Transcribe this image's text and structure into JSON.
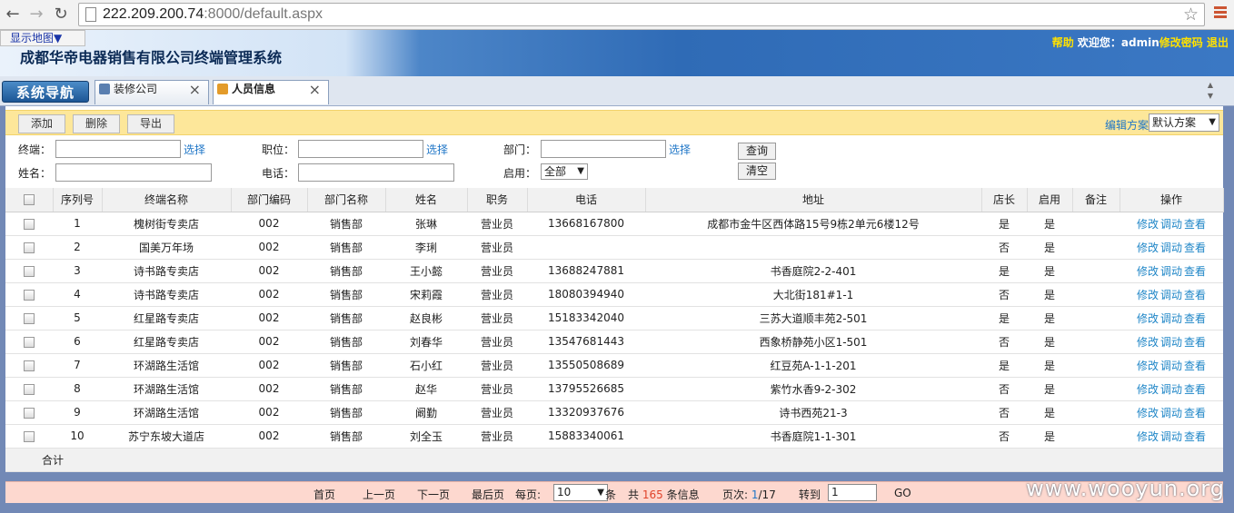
{
  "browser": {
    "url_host": "222.209.200.74",
    "url_rest": ":8000/default.aspx"
  },
  "header": {
    "map_toggle": "显示地图▼",
    "title": "成都华帝电器销售有限公司终端管理系统",
    "help": "帮助",
    "welcome": "欢迎您：admin",
    "change_password": "修改密码",
    "logout": "退出"
  },
  "tabs": {
    "system_nav": "系统导航",
    "items": [
      {
        "label": "装修公司"
      },
      {
        "label": "人员信息"
      }
    ],
    "close_glyph": "×"
  },
  "toolbar": {
    "add": "添加",
    "delete": "删除",
    "export": "导出",
    "edit_scheme": "编辑方案",
    "scheme_value": "默认方案"
  },
  "filters": {
    "terminal_label": "终端：",
    "position_label": "职位：",
    "department_label": "部门：",
    "name_label": "姓名：",
    "phone_label": "电话：",
    "enabled_label": "启用：",
    "pick": "选择",
    "enabled_value": "全部",
    "query": "查询",
    "clear": "清空"
  },
  "table": {
    "headers": [
      "序列号",
      "终端名称",
      "部门编码",
      "部门名称",
      "姓名",
      "职务",
      "电话",
      "地址",
      "店长",
      "启用",
      "备注",
      "操作"
    ],
    "actions": [
      "修改",
      "调动",
      "查看"
    ],
    "rows": [
      {
        "no": "1",
        "terminal": "槐树街专卖店",
        "dept_code": "002",
        "dept": "销售部",
        "name": "张琳",
        "role": "营业员",
        "phone": "13668167800",
        "address": "成都市金牛区西体路15号9栋2单元6楼12号",
        "manager": "是",
        "enabled": "是",
        "note": ""
      },
      {
        "no": "2",
        "terminal": "国美万年场",
        "dept_code": "002",
        "dept": "销售部",
        "name": "李琍",
        "role": "营业员",
        "phone": "",
        "address": "",
        "manager": "否",
        "enabled": "是",
        "note": ""
      },
      {
        "no": "3",
        "terminal": "诗书路专卖店",
        "dept_code": "002",
        "dept": "销售部",
        "name": "王小懿",
        "role": "营业员",
        "phone": "13688247881",
        "address": "书香庭院2-2-401",
        "manager": "是",
        "enabled": "是",
        "note": ""
      },
      {
        "no": "4",
        "terminal": "诗书路专卖店",
        "dept_code": "002",
        "dept": "销售部",
        "name": "宋莉霞",
        "role": "营业员",
        "phone": "18080394940",
        "address": "大北街181#1-1",
        "manager": "否",
        "enabled": "是",
        "note": ""
      },
      {
        "no": "5",
        "terminal": "红星路专卖店",
        "dept_code": "002",
        "dept": "销售部",
        "name": "赵良彬",
        "role": "营业员",
        "phone": "15183342040",
        "address": "三苏大道顺丰苑2-501",
        "manager": "是",
        "enabled": "是",
        "note": ""
      },
      {
        "no": "6",
        "terminal": "红星路专卖店",
        "dept_code": "002",
        "dept": "销售部",
        "name": "刘春华",
        "role": "营业员",
        "phone": "13547681443",
        "address": "西象桥静苑小区1-501",
        "manager": "否",
        "enabled": "是",
        "note": ""
      },
      {
        "no": "7",
        "terminal": "环湖路生活馆",
        "dept_code": "002",
        "dept": "销售部",
        "name": "石小红",
        "role": "营业员",
        "phone": "13550508689",
        "address": "红豆苑A-1-1-201",
        "manager": "是",
        "enabled": "是",
        "note": ""
      },
      {
        "no": "8",
        "terminal": "环湖路生活馆",
        "dept_code": "002",
        "dept": "销售部",
        "name": "赵华",
        "role": "营业员",
        "phone": "13795526685",
        "address": "紫竹水香9-2-302",
        "manager": "否",
        "enabled": "是",
        "note": ""
      },
      {
        "no": "9",
        "terminal": "环湖路生活馆",
        "dept_code": "002",
        "dept": "销售部",
        "name": "阚勤",
        "role": "营业员",
        "phone": "13320937676",
        "address": "诗书西苑21-3",
        "manager": "否",
        "enabled": "是",
        "note": ""
      },
      {
        "no": "10",
        "terminal": "苏宁东坡大道店",
        "dept_code": "002",
        "dept": "销售部",
        "name": "刘全玉",
        "role": "营业员",
        "phone": "15883340061",
        "address": "书香庭院1-1-301",
        "manager": "否",
        "enabled": "是",
        "note": ""
      }
    ],
    "total_label": "合计"
  },
  "pager": {
    "first": "首页",
    "prev": "上一页",
    "next": "下一页",
    "last": "最后页",
    "per_page_label": "每页:",
    "per_page": "10",
    "unit": "条",
    "total_prefix": "共",
    "total": "165",
    "total_suffix": "条信息",
    "page_label": "页次:",
    "page_current": "1",
    "page_total": "/17",
    "goto_label": "转到",
    "goto_value": "1",
    "go": "GO"
  },
  "watermark": "www.wooyun.org",
  "colors": {
    "toolbar_bg": "#fde79a",
    "pager_bg": "#fdd8cf",
    "link": "#1f86c7",
    "page_bg": "#7289b6"
  }
}
